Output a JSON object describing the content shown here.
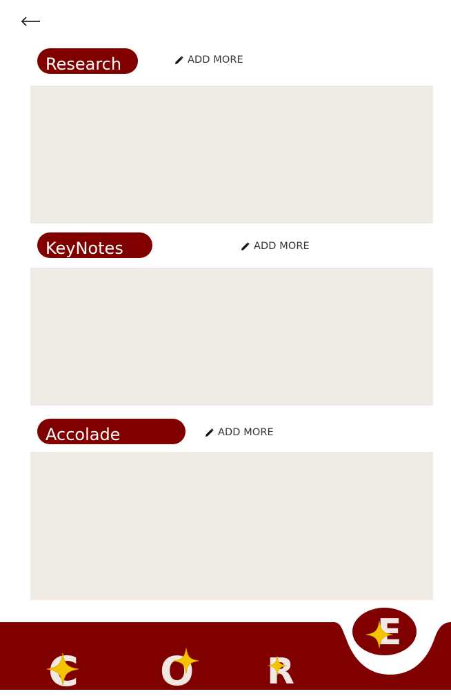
{
  "sections": [
    {
      "title": "Research",
      "action_label": "ADD MORE"
    },
    {
      "title": "KeyNotes",
      "action_label": "ADD MORE"
    },
    {
      "title": "Accolade",
      "action_label": "ADD MORE"
    }
  ],
  "nav": {
    "items": [
      {
        "letter": "C"
      },
      {
        "letter": "O"
      },
      {
        "letter": "R"
      },
      {
        "letter": "E"
      }
    ]
  },
  "colors": {
    "brand": "#800000",
    "panel": "#f0ebe5",
    "star": "#f5c400",
    "letter": "#f1e9e1"
  },
  "icons": {
    "back": "arrow-left-icon",
    "edit": "pencil-icon",
    "star": "sparkle-star-icon"
  }
}
